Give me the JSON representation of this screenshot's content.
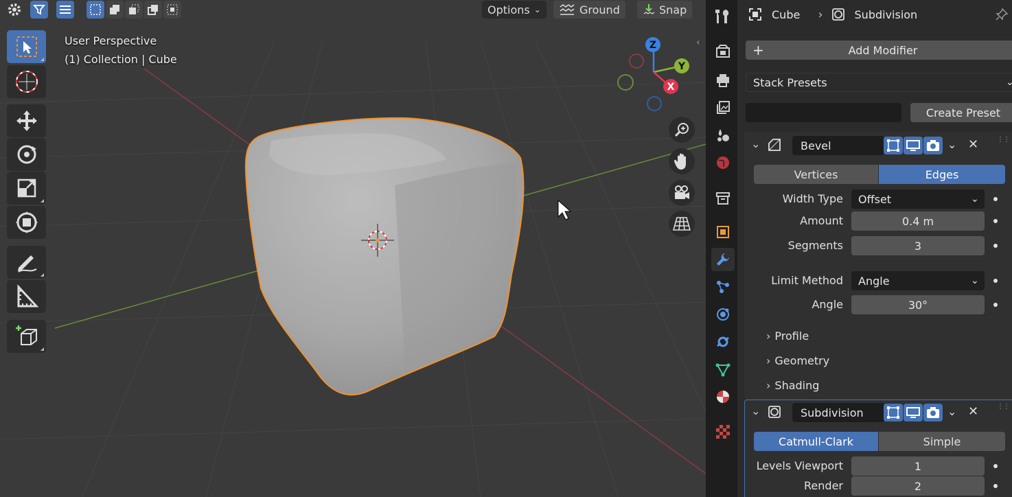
{
  "topbar": {
    "options_label": "Options",
    "ground_label": "Ground",
    "snap_label": "Snap"
  },
  "viewport": {
    "perspective_label": "User Perspective",
    "collection_label": "(1) Collection | Cube",
    "gizmo": {
      "z": "Z",
      "y": "Y",
      "x": "X"
    }
  },
  "breadcrumb": {
    "object": "Cube",
    "modifier": "Subdivision"
  },
  "properties": {
    "add_modifier_label": "Add Modifier",
    "stack_presets_label": "Stack Presets",
    "preset_name_value": "",
    "create_preset_label": "Create Preset",
    "bevel": {
      "name": "Bevel",
      "tabs": [
        "Vertices",
        "Edges"
      ],
      "active_tab": "Edges",
      "width_type_label": "Width Type",
      "width_type_value": "Offset",
      "amount_label": "Amount",
      "amount_value": "0.4 m",
      "segments_label": "Segments",
      "segments_value": "3",
      "limit_method_label": "Limit Method",
      "limit_method_value": "Angle",
      "angle_label": "Angle",
      "angle_value": "30°",
      "subpanels": [
        "Profile",
        "Geometry",
        "Shading"
      ]
    },
    "subdivision": {
      "name": "Subdivision",
      "tabs": [
        "Catmull-Clark",
        "Simple"
      ],
      "active_tab": "Catmull-Clark",
      "levels_viewport_label": "Levels Viewport",
      "levels_viewport_value": "1",
      "render_label": "Render",
      "render_value": "2"
    }
  },
  "colors": {
    "accent": "#4772b3",
    "selection_outline": "#f0922e",
    "axis_x": "#e0364f",
    "axis_y": "#8cb53a",
    "axis_z": "#3a83e0"
  }
}
